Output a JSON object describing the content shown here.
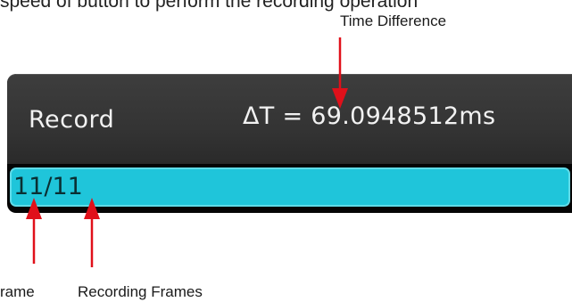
{
  "top_text_fragment": "speed of button to perform the recording operation",
  "callouts": {
    "time_difference": "Time Difference",
    "current_frame": "rame",
    "recording_frames": "Recording Frames"
  },
  "screen": {
    "record_label": "Record",
    "delta_t": "ΔT = 69.0948512ms",
    "frame_counter": "11/11",
    "current_frame": 11,
    "total_frames": 11,
    "progress_fraction": 1.0
  },
  "colors": {
    "bar_background": "#343434",
    "progress_fill": "#1fc5da",
    "text_light": "#f2f2f2",
    "arrow": "#e0101a"
  }
}
